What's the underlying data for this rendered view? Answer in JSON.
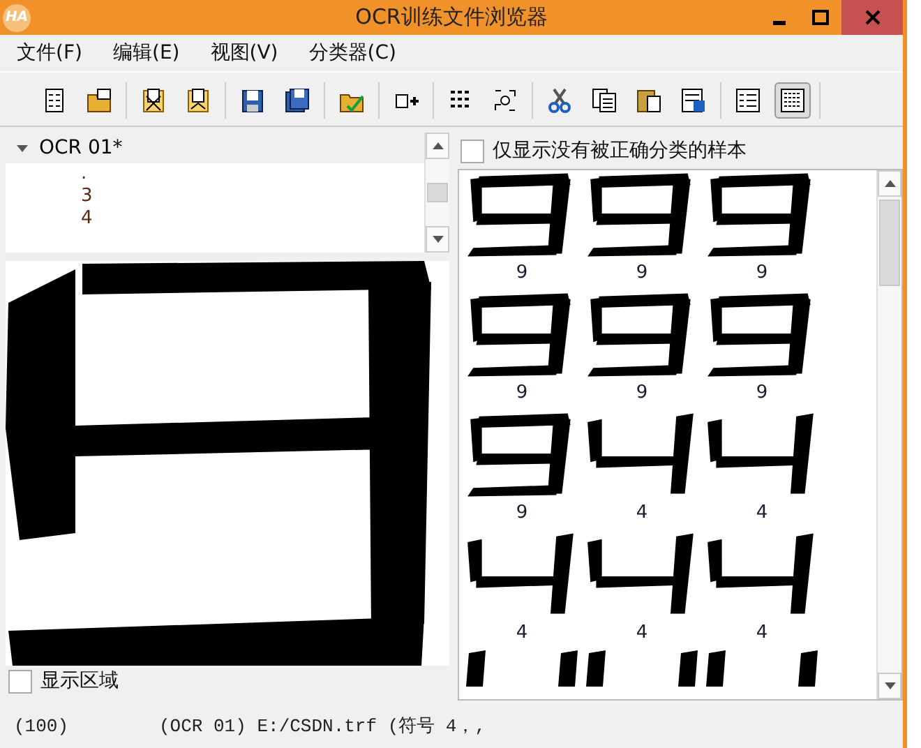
{
  "window": {
    "logo": "HA",
    "title": "OCR训练文件浏览器"
  },
  "menu": [
    "文件(F)",
    "编辑(E)",
    "视图(V)",
    "分类器(C)"
  ],
  "toolbar": [
    [
      {
        "kind": "doc",
        "selected": false
      },
      {
        "kind": "folder",
        "selected": false
      }
    ],
    [
      {
        "kind": "mark-doc",
        "selected": false
      },
      {
        "kind": "mark-doc2",
        "selected": false
      }
    ],
    [
      {
        "kind": "floppy",
        "selected": false
      },
      {
        "kind": "floppy2",
        "selected": false
      }
    ],
    [
      {
        "kind": "folder-check",
        "selected": false
      }
    ],
    [
      {
        "kind": "add",
        "selected": false
      }
    ],
    [
      {
        "kind": "letters",
        "selected": false
      },
      {
        "kind": "scatter",
        "selected": false
      }
    ],
    [
      {
        "kind": "scissors",
        "selected": false
      },
      {
        "kind": "copy",
        "selected": false
      },
      {
        "kind": "paste",
        "selected": false
      },
      {
        "kind": "delete",
        "selected": false
      }
    ],
    [
      {
        "kind": "list",
        "selected": false
      },
      {
        "kind": "grid",
        "selected": true
      }
    ]
  ],
  "tree": {
    "label": "OCR 01*",
    "expanded": true,
    "children": [
      ".",
      "3",
      "4"
    ]
  },
  "preview": {
    "kind": "nine"
  },
  "show_region": {
    "label": "显示区域",
    "checked": false
  },
  "filter": {
    "label": "仅显示没有被正确分类的样本",
    "checked": false
  },
  "samples": [
    {
      "kind": "nine",
      "label": "9"
    },
    {
      "kind": "nine",
      "label": "9"
    },
    {
      "kind": "nine",
      "label": "9"
    },
    {
      "kind": "nine",
      "label": "9"
    },
    {
      "kind": "nine",
      "label": "9"
    },
    {
      "kind": "nine",
      "label": "9"
    },
    {
      "kind": "nine",
      "label": "9"
    },
    {
      "kind": "four",
      "label": "4"
    },
    {
      "kind": "four",
      "label": "4"
    },
    {
      "kind": "four",
      "label": "4"
    },
    {
      "kind": "four",
      "label": "4"
    },
    {
      "kind": "four",
      "label": "4"
    },
    {
      "kind": "stub"
    },
    {
      "kind": "stub"
    },
    {
      "kind": "stub"
    }
  ],
  "status": [
    "(100)",
    "(OCR 01) E:/CSDN.trf (符号 4，,"
  ]
}
